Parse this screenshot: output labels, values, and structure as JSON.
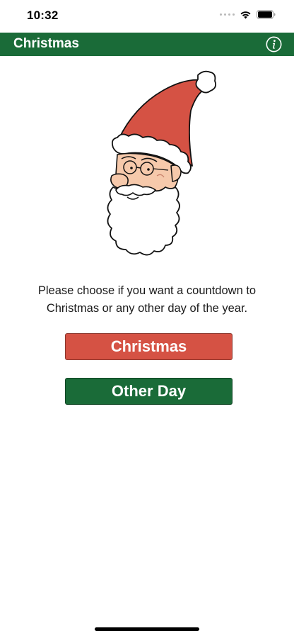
{
  "status_bar": {
    "time": "10:32",
    "icons": [
      "signal-dots-icon",
      "wifi-icon",
      "battery-icon"
    ]
  },
  "nav_bar": {
    "title": "Christmas",
    "info_icon": "info-icon",
    "color": "#1a6b38"
  },
  "illustration": {
    "icon": "santa-claus-illustration"
  },
  "prompt": {
    "line1": "Please choose if you want a countdown to",
    "line2": "Christmas or any other day of the year."
  },
  "buttons": {
    "christmas_label": "Christmas",
    "christmas_color": "#d55244",
    "other_day_label": "Other Day",
    "other_day_color": "#1a6b38"
  }
}
